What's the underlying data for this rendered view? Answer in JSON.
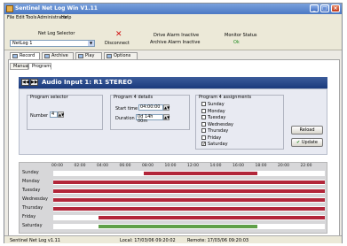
{
  "window": {
    "title": "Sentinel Net Log Win V1.11"
  },
  "menu": [
    "File",
    "Edit",
    "Tools",
    "Administrator",
    "Help"
  ],
  "toolbar": {
    "netlog_selector_label": "Net Log Selector",
    "netlog_value": "NetLog 1",
    "disconnect_label": "Disconnect",
    "alarm1": "Drive Alarm Inactive",
    "alarm2": "Archive Alarm Inactive",
    "monitor_label": "Monitor Status",
    "monitor_value": "Ok"
  },
  "main_tabs": [
    "Record",
    "Archive",
    "Play",
    "Options"
  ],
  "sub_tabs": [
    "Manual",
    "Program"
  ],
  "header": {
    "title": "Audio Input 1:  R1 STEREO"
  },
  "program_selector": {
    "title": "Program selector",
    "number_label": "Number",
    "number_value": "4"
  },
  "program_details": {
    "title": "Program 4 details",
    "start_label": "Start time",
    "start_value": "04:00:00",
    "duration_label": "Duration",
    "duration_value": "0d 14h 00m"
  },
  "assignments": {
    "title": "Program 4 assignments",
    "days": [
      {
        "name": "Sunday",
        "checked": false
      },
      {
        "name": "Monday",
        "checked": false
      },
      {
        "name": "Tuesday",
        "checked": false
      },
      {
        "name": "Wednesday",
        "checked": false
      },
      {
        "name": "Thursday",
        "checked": false
      },
      {
        "name": "Friday",
        "checked": false
      },
      {
        "name": "Saturday",
        "checked": true
      }
    ]
  },
  "buttons": {
    "reload": "Reload",
    "update": "Update"
  },
  "schedule": {
    "hours": [
      "00:00",
      "02:00",
      "04:00",
      "06:00",
      "08:00",
      "10:00",
      "12:00",
      "14:00",
      "16:00",
      "18:00",
      "20:00",
      "22:00"
    ],
    "rows": [
      {
        "day": "Sunday",
        "bars": [
          {
            "start": 8,
            "end": 18,
            "color": "#b2263a"
          }
        ]
      },
      {
        "day": "Monday",
        "bars": [
          {
            "start": 0,
            "end": 24,
            "color": "#b2263a"
          }
        ]
      },
      {
        "day": "Tuesday",
        "bars": [
          {
            "start": 0,
            "end": 24,
            "color": "#b2263a"
          }
        ]
      },
      {
        "day": "Wednesday",
        "bars": [
          {
            "start": 0,
            "end": 24,
            "color": "#b2263a"
          }
        ]
      },
      {
        "day": "Thursday",
        "bars": [
          {
            "start": 0,
            "end": 24,
            "color": "#b2263a"
          }
        ]
      },
      {
        "day": "Friday",
        "bars": [
          {
            "start": 4,
            "end": 24,
            "color": "#b2263a"
          }
        ]
      },
      {
        "day": "Saturday",
        "bars": [
          {
            "start": 4,
            "end": 18,
            "color": "#5fa048"
          }
        ]
      }
    ]
  },
  "status": {
    "left": "Sentinel Net Log v1.11",
    "middle": "Local: 17/03/06 09:20:02",
    "right": "Remote: 17/03/06 09:20:03"
  }
}
